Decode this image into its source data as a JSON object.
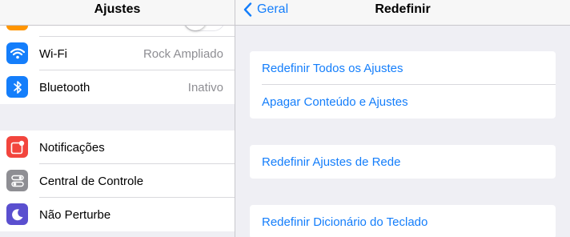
{
  "left": {
    "title": "Ajustes",
    "group1": [
      {
        "label": "Wi-Fi",
        "value": "Rock Ampliado",
        "icon": "wifi-icon",
        "color": "#147efb"
      },
      {
        "label": "Bluetooth",
        "value": "Inativo",
        "icon": "bluetooth-icon",
        "color": "#147efb"
      }
    ],
    "group2": [
      {
        "label": "Notificações",
        "icon": "notifications-icon",
        "color": "#f2453d"
      },
      {
        "label": "Central de Controle",
        "icon": "control-center-icon",
        "color": "#8e8e93"
      },
      {
        "label": "Não Perturbe",
        "icon": "moon-icon",
        "color": "#5a4fcf"
      }
    ]
  },
  "right": {
    "back_label": "Geral",
    "title": "Redefinir",
    "cards": [
      [
        "Redefinir Todos os Ajustes",
        "Apagar Conteúdo e Ajustes"
      ],
      [
        "Redefinir Ajustes de Rede"
      ],
      [
        "Redefinir Dicionário do Teclado"
      ]
    ]
  },
  "colors": {
    "accent": "#147efb",
    "background": "#efeff4"
  }
}
